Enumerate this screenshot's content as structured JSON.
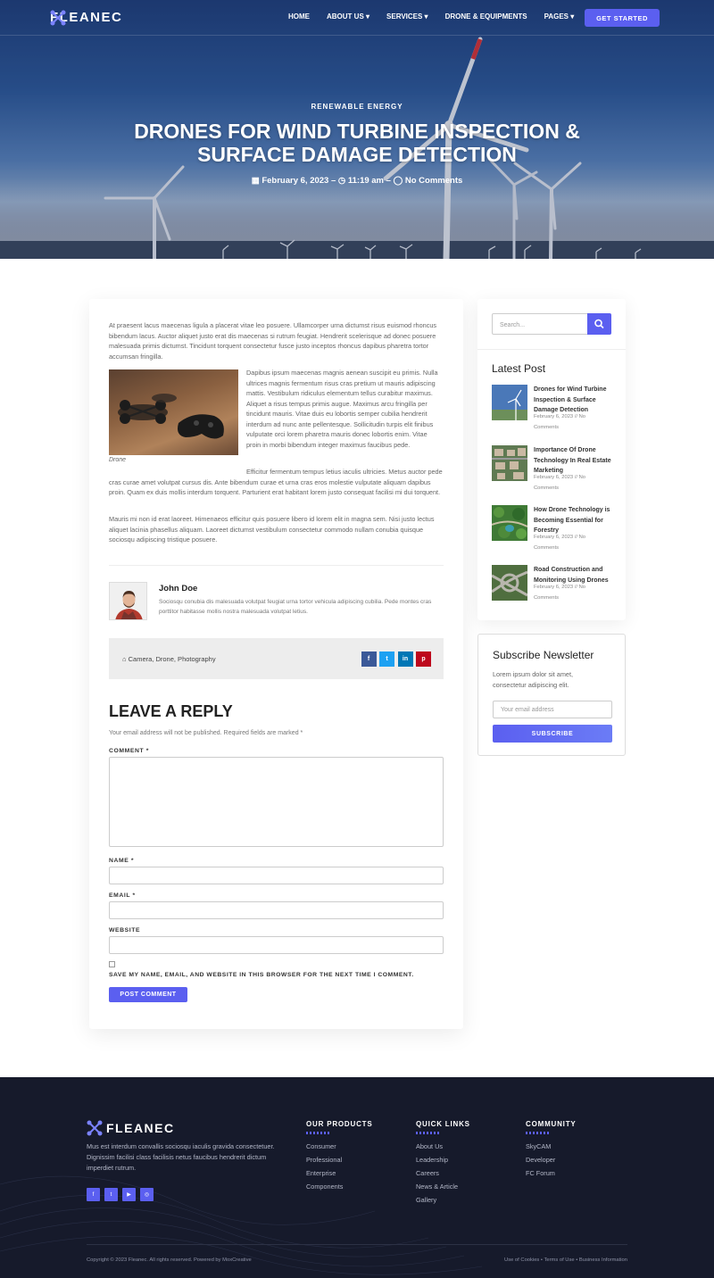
{
  "nav": {
    "brand": "FLEANEC",
    "links": [
      "HOME",
      "ABOUT US ▾",
      "SERVICES ▾",
      "DRONE & EQUIPMENTS",
      "PAGES ▾"
    ],
    "cta": "GET STARTED"
  },
  "hero": {
    "category": "RENEWABLE ENERGY",
    "title": "DRONES FOR WIND TURBINE INSPECTION & SURFACE DAMAGE DETECTION",
    "date": "February 6, 2023",
    "time": "11:19 am",
    "comments": "No Comments"
  },
  "article": {
    "p1": "At praesent lacus maecenas ligula a placerat vitae leo posuere. Ullamcorper urna dictumst risus euismod rhoncus bibendum lacus. Auctor aliquet justo erat dis maecenas si rutrum feugiat. Hendrerit scelerisque ad donec posuere malesuada primis dictumst. Tincidunt torquent consectetur fusce justo inceptos rhoncus dapibus pharetra tortor accumsan fringilla.",
    "p2": "Dapibus ipsum maecenas magnis aenean suscipit eu primis. Nulla ultrices magnis fermentum risus cras pretium ut mauris adipiscing mattis. Vestibulum ridiculus elementum tellus curabitur maximus. Aliquet a risus tempus primis augue. Maximus arcu fringilla per tincidunt mauris. Vitae duis eu lobortis semper cubilia hendrerit interdum ad nunc ante pellentesque. Sollicitudin turpis elit finibus vulputate orci lorem pharetra mauris donec lobortis enim. Vitae proin in morbi bibendum integer maximus faucibus pede.",
    "p3": "Efficitur fermentum tempus letius iaculis ultricies. Metus auctor pede cras curae amet volutpat cursus dis. Ante bibendum curae et urna cras eros molestie vulputate aliquam dapibus proin. Quam ex duis mollis interdum torquent. Parturient erat habitant lorem justo consequat facilisi mi dui torquent.",
    "p4": "Mauris mi non id erat laoreet. Himenaeos efficitur quis posuere libero id lorem elit in magna sem. Nisi justo lectus aliquet lacinia phasellus aliquam. Laoreet dictumst vestibulum consectetur commodo nullam conubia quisque sociosqu adipiscing tristique posuere.",
    "image_caption": "Drone"
  },
  "author": {
    "name": "John Doe",
    "bio": "Sociosqu conubia dis malesuada volutpat feugiat urna tortor vehicula adipiscing cubilia. Pede montes cras porttitor habitasse mollis nostra malesuada volutpat letius."
  },
  "tags": {
    "text": "Camera, Drone, Photography"
  },
  "share": [
    {
      "name": "facebook",
      "glyph": "f",
      "color": "#3b5998"
    },
    {
      "name": "twitter",
      "glyph": "t",
      "color": "#1da1f2"
    },
    {
      "name": "linkedin",
      "glyph": "in",
      "color": "#0077b5"
    },
    {
      "name": "pinterest",
      "glyph": "p",
      "color": "#bd081c"
    }
  ],
  "reply": {
    "title": "LEAVE A REPLY",
    "note": "Your email address will not be published. Required fields are marked *",
    "comment_label": "COMMENT *",
    "name_label": "NAME *",
    "email_label": "EMAIL *",
    "website_label": "WEBSITE",
    "save_label": "SAVE MY NAME, EMAIL, AND WEBSITE IN THIS BROWSER FOR THE NEXT TIME I COMMENT.",
    "submit": "POST COMMENT"
  },
  "sidebar": {
    "search_placeholder": "Search...",
    "latest_title": "Latest Post",
    "posts": [
      {
        "title": "Drones for Wind Turbine Inspection & Surface Damage Detection",
        "meta": "February 6, 2023 // No Comments"
      },
      {
        "title": "Importance Of Drone Technology In Real Estate Marketing",
        "meta": "February 6, 2023 // No Comments"
      },
      {
        "title": "How Drone Technology is Becoming Essential for Forestry",
        "meta": "February 6, 2023 // No Comments"
      },
      {
        "title": "Road Construction and Monitoring Using Drones",
        "meta": "February 6, 2023 // No Comments"
      }
    ],
    "subscribe_title": "Subscribe Newsletter",
    "subscribe_desc": "Lorem ipsum dolor sit amet, consectetur adipiscing elit.",
    "email_placeholder": "Your email address",
    "subscribe_btn": "SUBSCRIBE"
  },
  "footer": {
    "brand": "FLEANEC",
    "desc": "Mus est interdum convallis sociosqu iaculis gravida consectetuer. Dignissim facilisi class facilisis netus faucibus hendrerit dictum imperdiet rutrum.",
    "social": [
      {
        "name": "facebook",
        "glyph": "f"
      },
      {
        "name": "twitter",
        "glyph": "t"
      },
      {
        "name": "youtube",
        "glyph": "▶"
      },
      {
        "name": "instagram",
        "glyph": "◎"
      }
    ],
    "cols": [
      {
        "title": "OUR PRODUCTS",
        "items": [
          "Consumer",
          "Professional",
          "Enterprise",
          "Components"
        ]
      },
      {
        "title": "QUICK LINKS",
        "items": [
          "About Us",
          "Leadership",
          "Careers",
          "News & Article",
          "Gallery"
        ]
      },
      {
        "title": "COMMUNITY",
        "items": [
          "SkyCAM",
          "Developer",
          "FC Forum"
        ]
      }
    ],
    "copyright": "Copyright © 2023 Fleanec. All rights reserved. Powered by MoxCreative",
    "legal": "Use of Cookies  •  Terms of Use  •  Business Information"
  },
  "colors": {
    "accent": "#5b5ff0",
    "footer_bg": "#161a2b"
  }
}
